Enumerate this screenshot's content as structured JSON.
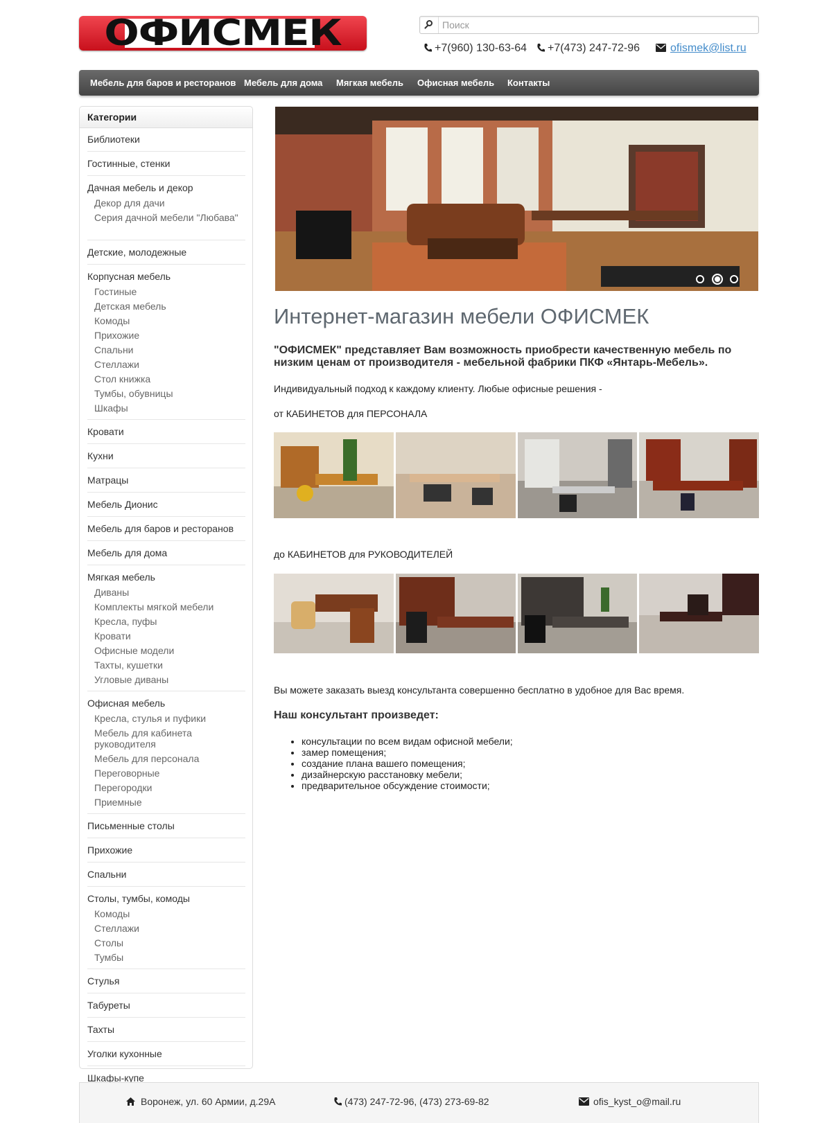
{
  "header": {
    "logo_text": "ОФИСМЕК",
    "search_placeholder": "Поиск",
    "phone1": "+7(960) 130-63-64",
    "phone2": "+7(473) 247-72-96",
    "email": "ofismek@list.ru"
  },
  "nav": {
    "items": [
      "Мебель для баров и ресторанов",
      "Мебель для дома",
      "Мягкая мебель",
      "Офисная мебель",
      "Контакты"
    ]
  },
  "sidebar": {
    "title": "Категории",
    "categories": [
      {
        "label": "Библиотеки",
        "subs": []
      },
      {
        "label": "Гостинные, стенки",
        "subs": []
      },
      {
        "label": "Дачная мебель и декор",
        "subs": [
          "Декор для дачи",
          "Серия дачной мебели \"Любава\""
        ]
      },
      {
        "label": "Детские, молодежные",
        "subs": []
      },
      {
        "label": "Корпусная мебель",
        "subs": [
          "Гостиные",
          "Детская мебель",
          "Комоды",
          "Прихожие",
          "Спальни",
          "Стеллажи",
          "Стол книжка",
          "Тумбы, обувницы",
          "Шкафы"
        ]
      },
      {
        "label": "Кровати",
        "subs": []
      },
      {
        "label": "Кухни",
        "subs": []
      },
      {
        "label": "Матрацы",
        "subs": []
      },
      {
        "label": "Мебель Дионис",
        "subs": []
      },
      {
        "label": "Мебель для баров и ресторанов",
        "subs": []
      },
      {
        "label": "Мебель для дома",
        "subs": []
      },
      {
        "label": "Мягкая мебель",
        "subs": [
          "Диваны",
          "Комплекты мягкой мебели",
          "Кресла, пуфы",
          "Кровати",
          "Офисные модели",
          "Тахты, кушетки",
          "Угловые диваны"
        ]
      },
      {
        "label": "Офисная мебель",
        "subs": [
          "Кресла, стулья и пуфики",
          "Мебель для кабинета руководителя",
          "Мебель для персонала",
          "Переговорные",
          "Перегородки",
          "Приемные"
        ]
      },
      {
        "label": "Письменные столы",
        "subs": []
      },
      {
        "label": "Прихожие",
        "subs": []
      },
      {
        "label": "Спальни",
        "subs": []
      },
      {
        "label": "Столы, тумбы, комоды",
        "subs": [
          "Комоды",
          "Стеллажи",
          "Столы",
          "Тумбы"
        ]
      },
      {
        "label": "Стулья",
        "subs": []
      },
      {
        "label": "Табуреты",
        "subs": []
      },
      {
        "label": "Тахты",
        "subs": []
      },
      {
        "label": "Уголки кухонные",
        "subs": []
      },
      {
        "label": "Шкафы-купе",
        "subs": []
      }
    ]
  },
  "main": {
    "slider_active_slide": 2,
    "slider_slide_count": 3,
    "title": "Интернет-магазин мебели ОФИСМЕК",
    "lead": "\"ОФИСМЕК\" представляет Вам возможность приобрести качественную мебель по низким ценам от производителя - мебельной фабрики ПКФ «Янтарь-Мебель».",
    "intro": "Индивидуальный подход к каждому клиенту. Любые офисные решения -",
    "from_staff": "от КАБИНЕТОВ для ПЕРСОНАЛА",
    "to_managers": "до КАБИНЕТОВ для РУКОВОДИТЕЛЕЙ",
    "consult": "Вы можете заказать выезд консультанта совершенно бесплатно в удобное для Вас время.",
    "consult_title": "Наш консультант произведет:",
    "consult_items": [
      "консультации по всем видам офисной мебели;",
      "замер помещения;",
      "создание плана вашего помещения;",
      "дизайнерскую расстановку мебели;",
      "предварительное обсуждение стоимости;"
    ]
  },
  "footer": {
    "address": "Воронеж, ул. 60 Армии, д.29А",
    "phones": "(473) 247-72-96, (473) 273-69-82",
    "email": "ofis_kyst_o@mail.ru"
  }
}
